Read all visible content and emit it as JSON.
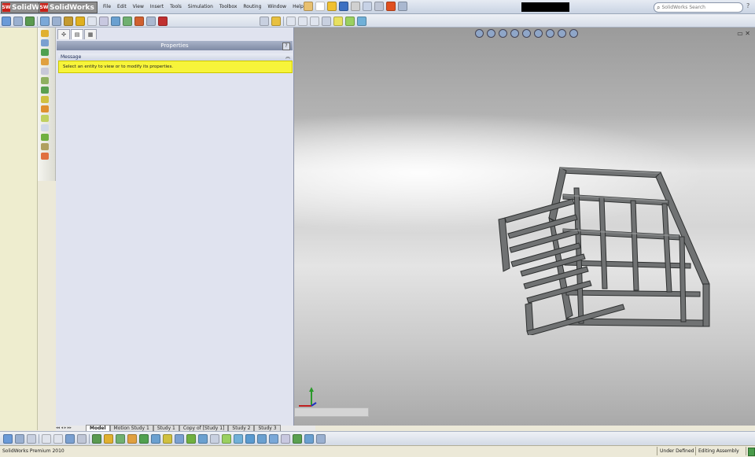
{
  "app": {
    "logo_short": "SolidW",
    "logo_full": "SolidWorks"
  },
  "menu": [
    "File",
    "Edit",
    "View",
    "Insert",
    "Tools",
    "Simulation",
    "Toolbox",
    "Routing",
    "Window",
    "Help"
  ],
  "search": {
    "placeholder": "SolidWorks Search",
    "help_icon": "?"
  },
  "property_manager": {
    "title": "Properties",
    "help_label": "?",
    "message_group_label": "Message",
    "message_text": "Select an entity to view or to modify its properties."
  },
  "tabs": [
    {
      "label": "Model",
      "active": true
    },
    {
      "label": "Motion Study 1",
      "active": false
    },
    {
      "label": "Study 1",
      "active": false
    },
    {
      "label": "Copy of [Study 1]",
      "active": false
    },
    {
      "label": "Study 2",
      "active": false
    },
    {
      "label": "Study 3",
      "active": false
    }
  ],
  "status": {
    "product": "SolidWorks Premium 2010",
    "state": "Under Defined",
    "mode": "Editing Assembly"
  },
  "colors": {
    "accent_blue": "#7f8aa5",
    "message_yellow": "#f7f43a",
    "left_strip": "#eeedcf",
    "steel": "#6e7071"
  }
}
